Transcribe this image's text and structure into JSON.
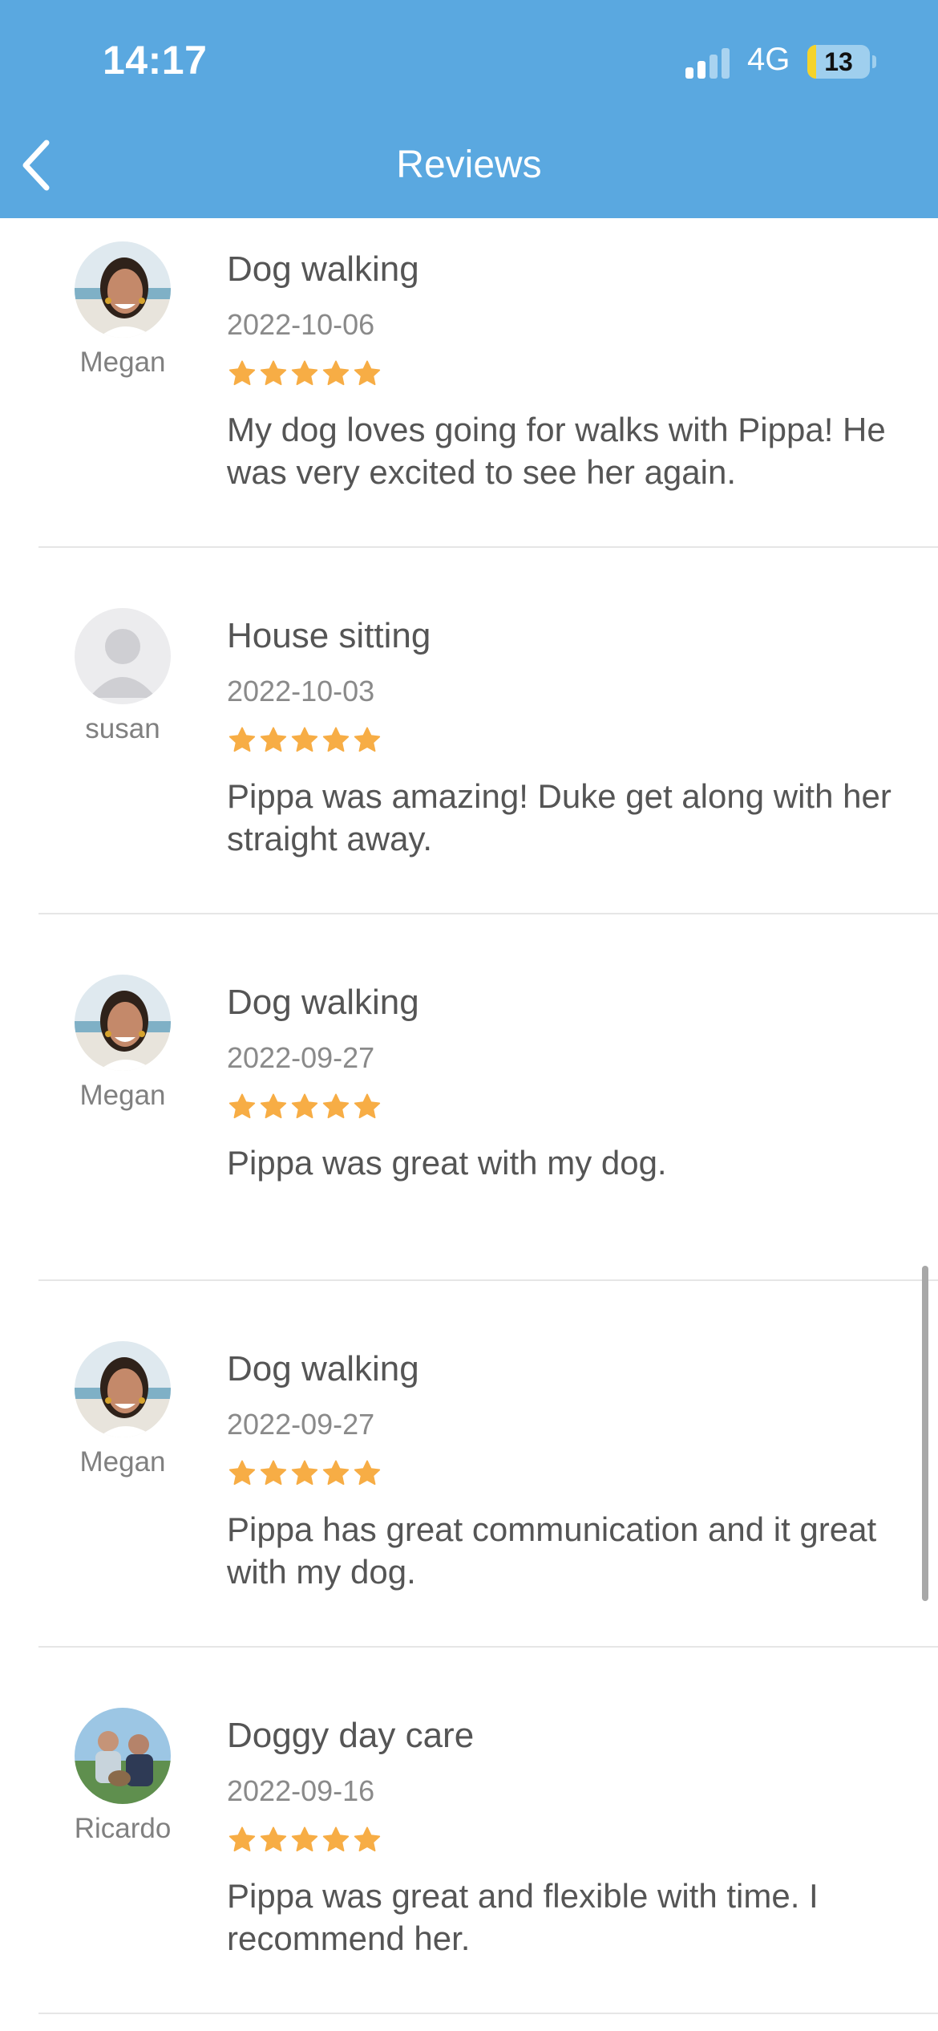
{
  "status_bar": {
    "time": "14:17",
    "network": "4G",
    "battery_level": "13"
  },
  "nav": {
    "title": "Reviews",
    "back_icon": "chevron-left-icon"
  },
  "colors": {
    "header": "#5aa8e0",
    "star": "#f7ad45",
    "text": "#555555",
    "subtext": "#8a8a8a"
  },
  "reviews": [
    {
      "reviewer": "Megan",
      "avatar": "photo",
      "service": "Dog walking",
      "date": "2022-10-06",
      "rating": 5,
      "comment": "My dog loves going for walks with Pippa! He was very excited to see her again."
    },
    {
      "reviewer": "susan",
      "avatar": "default-user-icon",
      "service": "House sitting",
      "date": "2022-10-03",
      "rating": 5,
      "comment": "Pippa was amazing! Duke get along with her straight away."
    },
    {
      "reviewer": "Megan",
      "avatar": "photo",
      "service": "Dog walking",
      "date": "2022-09-27",
      "rating": 5,
      "comment": "Pippa was great with my dog."
    },
    {
      "reviewer": "Megan",
      "avatar": "photo",
      "service": "Dog walking",
      "date": "2022-09-27",
      "rating": 5,
      "comment": "Pippa has great communication and it great with my dog."
    },
    {
      "reviewer": "Ricardo",
      "avatar": "photo",
      "service": "Doggy day care",
      "date": "2022-09-16",
      "rating": 5,
      "comment": "Pippa was great and flexible with time. I recommend her."
    }
  ]
}
